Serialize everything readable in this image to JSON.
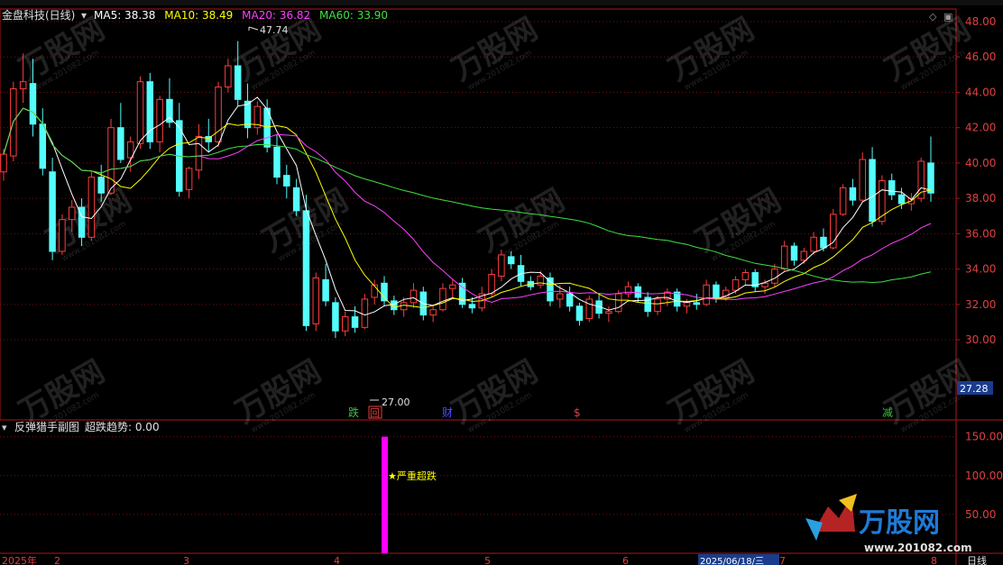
{
  "main_chart": {
    "stock_name": "金盘科技(日线)",
    "ma_items": [
      {
        "label": "MA5: 38.38",
        "color": "#ffffff"
      },
      {
        "label": "MA10: 38.49",
        "color": "#ffff00"
      },
      {
        "label": "MA20: 36.82",
        "color": "#ff40ff"
      },
      {
        "label": "MA60: 33.90",
        "color": "#40e040"
      }
    ],
    "high_label": "47.74",
    "low_label": "27.00",
    "price_marker": "27.28",
    "y_ticks": [
      "48.00",
      "46.00",
      "44.00",
      "42.00",
      "40.00",
      "38.00",
      "36.00",
      "34.00",
      "32.00",
      "30.00"
    ],
    "ylim": [
      27.3,
      48.0
    ],
    "event_markers": [
      {
        "text": "跌",
        "color": "#40c040"
      },
      {
        "text": "回",
        "color": "#e04040"
      },
      {
        "text": "财",
        "color": "#4040ff"
      },
      {
        "text": "$",
        "color": "#e04040"
      },
      {
        "text": "减",
        "color": "#40c040"
      }
    ],
    "colors": {
      "up": "#ff3c3c",
      "down": "#54fcfc",
      "grid": "#7a1010",
      "axis": "#b01818"
    }
  },
  "sub_chart": {
    "title": "反弹猎手副图",
    "indicator": "超跌趋势: 0.00",
    "y_ticks": [
      "150.00",
      "100.00",
      "50.00"
    ],
    "ylim": [
      0,
      160
    ],
    "bar_label": "★严重超跌",
    "bar_value": 150,
    "bar_color": "#ff00ff"
  },
  "x_axis": {
    "labels": [
      "2025年",
      "2",
      "3",
      "4",
      "5",
      "6",
      "7",
      "8"
    ],
    "crosshair_date": "2025/06/18/三",
    "period": "日线"
  },
  "watermark": {
    "brand": "万股网",
    "url": "www.201082.com"
  },
  "chart_data": {
    "type": "candlestick",
    "title": "金盘科技(日线)",
    "ylim": [
      27.3,
      48.0
    ],
    "annotations": {
      "high": 47.74,
      "low": 27.0,
      "current_marker": 27.28
    },
    "ma": {
      "MA5": 38.38,
      "MA10": 38.49,
      "MA20": 36.82,
      "MA60": 33.9
    },
    "candles": [
      [
        39.5,
        40.8,
        39.0,
        40.5
      ],
      [
        40.4,
        44.6,
        40.1,
        44.2
      ],
      [
        44.2,
        46.2,
        43.4,
        44.6
      ],
      [
        44.5,
        45.9,
        41.5,
        42.2
      ],
      [
        42.2,
        43.1,
        39.3,
        39.7
      ],
      [
        39.5,
        40.3,
        34.5,
        35.0
      ],
      [
        35.0,
        37.1,
        34.8,
        36.8
      ],
      [
        36.8,
        37.9,
        36.1,
        37.5
      ],
      [
        37.5,
        38.0,
        35.3,
        35.8
      ],
      [
        35.8,
        39.5,
        35.6,
        39.2
      ],
      [
        39.2,
        39.9,
        37.8,
        38.3
      ],
      [
        38.3,
        42.5,
        38.2,
        42.0
      ],
      [
        42.0,
        43.4,
        40.0,
        40.2
      ],
      [
        40.3,
        41.5,
        39.5,
        41.2
      ],
      [
        41.1,
        44.9,
        40.8,
        44.6
      ],
      [
        44.6,
        45.1,
        40.8,
        41.2
      ],
      [
        41.2,
        43.8,
        40.6,
        43.6
      ],
      [
        43.6,
        44.8,
        42.0,
        42.3
      ],
      [
        42.4,
        43.4,
        38.1,
        38.4
      ],
      [
        38.5,
        39.8,
        38.0,
        39.7
      ],
      [
        39.6,
        42.2,
        39.1,
        41.5
      ],
      [
        41.5,
        42.5,
        40.6,
        41.2
      ],
      [
        41.2,
        44.6,
        40.9,
        44.3
      ],
      [
        44.3,
        45.9,
        44.0,
        45.5
      ],
      [
        45.5,
        46.9,
        43.2,
        43.6
      ],
      [
        43.5,
        44.5,
        41.4,
        42.0
      ],
      [
        42.0,
        43.5,
        41.6,
        43.2
      ],
      [
        43.1,
        43.6,
        40.6,
        40.9
      ],
      [
        40.9,
        41.6,
        38.8,
        39.2
      ],
      [
        39.3,
        39.9,
        38.0,
        38.7
      ],
      [
        38.6,
        39.1,
        37.0,
        37.3
      ],
      [
        37.3,
        38.2,
        30.5,
        30.8
      ],
      [
        30.9,
        33.8,
        30.5,
        33.5
      ],
      [
        33.4,
        34.3,
        31.9,
        32.2
      ],
      [
        32.1,
        32.4,
        30.1,
        30.5
      ],
      [
        30.5,
        31.6,
        30.2,
        31.3
      ],
      [
        31.3,
        31.9,
        30.4,
        30.7
      ],
      [
        30.7,
        32.6,
        30.6,
        32.3
      ],
      [
        32.4,
        33.4,
        32.0,
        33.1
      ],
      [
        33.2,
        33.6,
        31.9,
        32.2
      ],
      [
        32.2,
        32.5,
        31.4,
        31.7
      ],
      [
        31.7,
        32.4,
        31.3,
        32.1
      ],
      [
        32.1,
        33.2,
        31.8,
        32.8
      ],
      [
        32.7,
        33.0,
        31.1,
        31.4
      ],
      [
        31.4,
        32.0,
        31.0,
        31.7
      ],
      [
        31.7,
        33.2,
        31.6,
        32.9
      ],
      [
        32.9,
        33.4,
        32.4,
        33.1
      ],
      [
        33.2,
        33.5,
        31.8,
        32.0
      ],
      [
        32.0,
        32.4,
        31.5,
        31.8
      ],
      [
        31.8,
        33.0,
        31.6,
        32.6
      ],
      [
        32.6,
        34.0,
        32.4,
        33.7
      ],
      [
        33.6,
        35.1,
        33.3,
        34.8
      ],
      [
        34.7,
        35.0,
        34.0,
        34.3
      ],
      [
        34.2,
        34.8,
        33.0,
        33.3
      ],
      [
        33.3,
        33.6,
        32.8,
        33.0
      ],
      [
        33.1,
        33.9,
        32.9,
        33.6
      ],
      [
        33.5,
        33.8,
        31.9,
        32.2
      ],
      [
        32.3,
        33.1,
        31.8,
        32.6
      ],
      [
        32.6,
        33.0,
        31.6,
        31.9
      ],
      [
        31.9,
        32.1,
        30.8,
        31.1
      ],
      [
        31.2,
        32.5,
        31.0,
        32.3
      ],
      [
        32.2,
        32.6,
        31.2,
        31.5
      ],
      [
        31.5,
        31.9,
        31.0,
        31.6
      ],
      [
        31.6,
        32.8,
        31.5,
        32.6
      ],
      [
        32.6,
        33.3,
        32.4,
        33.0
      ],
      [
        33.0,
        33.2,
        32.1,
        32.4
      ],
      [
        32.4,
        32.7,
        31.3,
        31.6
      ],
      [
        31.6,
        32.5,
        31.4,
        32.3
      ],
      [
        32.3,
        32.9,
        31.9,
        32.7
      ],
      [
        32.7,
        32.9,
        31.6,
        31.9
      ],
      [
        31.9,
        32.3,
        31.5,
        32.1
      ],
      [
        32.1,
        32.6,
        31.7,
        32.0
      ],
      [
        32.0,
        33.4,
        31.9,
        33.1
      ],
      [
        33.1,
        33.3,
        32.1,
        32.4
      ],
      [
        32.4,
        33.0,
        32.2,
        32.8
      ],
      [
        32.8,
        33.6,
        32.6,
        33.4
      ],
      [
        33.4,
        34.0,
        33.1,
        33.8
      ],
      [
        33.8,
        34.0,
        32.7,
        33.0
      ],
      [
        33.0,
        33.4,
        32.6,
        33.2
      ],
      [
        33.2,
        34.3,
        33.0,
        34.0
      ],
      [
        34.0,
        35.6,
        33.9,
        35.3
      ],
      [
        35.3,
        35.5,
        34.2,
        34.5
      ],
      [
        34.5,
        35.2,
        34.3,
        35.0
      ],
      [
        35.0,
        36.1,
        34.8,
        35.8
      ],
      [
        35.8,
        36.3,
        35.0,
        35.2
      ],
      [
        35.2,
        37.4,
        35.1,
        37.1
      ],
      [
        37.1,
        38.8,
        37.0,
        38.6
      ],
      [
        38.6,
        39.1,
        37.6,
        37.9
      ],
      [
        37.9,
        40.6,
        37.8,
        40.2
      ],
      [
        40.2,
        40.9,
        36.4,
        36.7
      ],
      [
        36.7,
        39.3,
        36.5,
        39.0
      ],
      [
        39.0,
        39.4,
        37.9,
        38.2
      ],
      [
        38.2,
        38.6,
        37.4,
        37.7
      ],
      [
        37.7,
        38.3,
        37.3,
        38.0
      ],
      [
        38.0,
        40.3,
        37.8,
        40.1
      ],
      [
        40.0,
        41.5,
        37.8,
        38.3
      ]
    ]
  }
}
